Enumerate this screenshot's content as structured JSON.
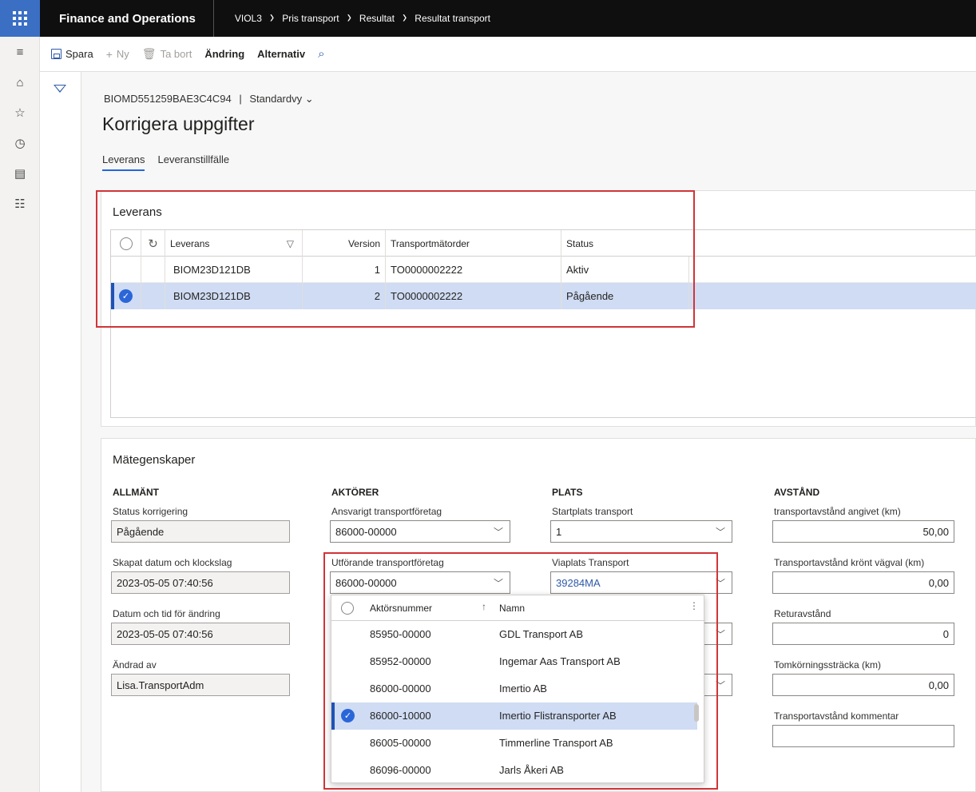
{
  "app": {
    "title": "Finance and Operations"
  },
  "breadcrumb": [
    "VIOL3",
    "Pris transport",
    "Resultat",
    "Resultat transport"
  ],
  "actions": {
    "save": "Spara",
    "new": "Ny",
    "delete": "Ta bort",
    "edit": "Ändring",
    "options": "Alternativ"
  },
  "page": {
    "record_id": "BIOMD551259BAE3C4C94",
    "separator": "|",
    "view": "Standardvy",
    "title": "Korrigera uppgifter"
  },
  "tabs": [
    "Leverans",
    "Leveranstillfälle"
  ],
  "leverans": {
    "title": "Leverans",
    "columns": {
      "leverans": "Leverans",
      "version": "Version",
      "order": "Transportmätorder",
      "status": "Status"
    },
    "rows": [
      {
        "leverans": "BIOM23D121DB",
        "version": "1",
        "order": "TO0000002222",
        "status": "Aktiv"
      },
      {
        "leverans": "BIOM23D121DB",
        "version": "2",
        "order": "TO0000002222",
        "status": "Pågående"
      }
    ]
  },
  "matt": {
    "title": "Mätegenskaper",
    "allmant": {
      "heading": "ALLMÄNT",
      "status_label": "Status korrigering",
      "status_value": "Pågående",
      "created_label": "Skapat datum och klockslag",
      "created_value": "2023-05-05 07:40:56",
      "changed_label": "Datum och tid för ändring",
      "changed_value": "2023-05-05 07:40:56",
      "changedby_label": "Ändrad av",
      "changedby_value": "Lisa.TransportAdm"
    },
    "aktorer": {
      "heading": "AKTÖRER",
      "responsible_label": "Ansvarigt transportföretag",
      "responsible_value": "86000-00000",
      "performing_label": "Utförande transportföretag",
      "performing_value": "86000-00000"
    },
    "plats": {
      "heading": "PLATS",
      "start_label": "Startplats transport",
      "start_value": "1",
      "via_label": "Viaplats Transport",
      "via_value": "39284MA"
    },
    "avstand": {
      "heading": "AVSTÅND",
      "given_label": "transportavstånd angivet (km)",
      "given_value": "50,00",
      "crowned_label": "Transportavstånd krönt vägval (km)",
      "crowned_value": "0,00",
      "return_label": "Returavstånd",
      "return_value": "0",
      "empty_label": "Tomkörningssträcka (km)",
      "empty_value": "0,00",
      "comment_label": "Transportavstånd kommentar",
      "comment_value": ""
    }
  },
  "lookup": {
    "col_number": "Aktörsnummer",
    "col_name": "Namn",
    "rows": [
      {
        "number": "85950-00000",
        "name": "GDL Transport AB"
      },
      {
        "number": "85952-00000",
        "name": "Ingemar Aas Transport AB"
      },
      {
        "number": "86000-00000",
        "name": "Imertio AB"
      },
      {
        "number": "86000-10000",
        "name": "Imertio Flistransporter AB"
      },
      {
        "number": "86005-00000",
        "name": "Timmerline Transport AB"
      },
      {
        "number": "86096-00000",
        "name": "Jarls Åkeri AB"
      }
    ],
    "selected_index": 3
  },
  "colors": {
    "accent": "#2266e3",
    "selection": "#cfdcf3",
    "highlight_box": "#d13438",
    "waffle": "#3a6fc4"
  }
}
